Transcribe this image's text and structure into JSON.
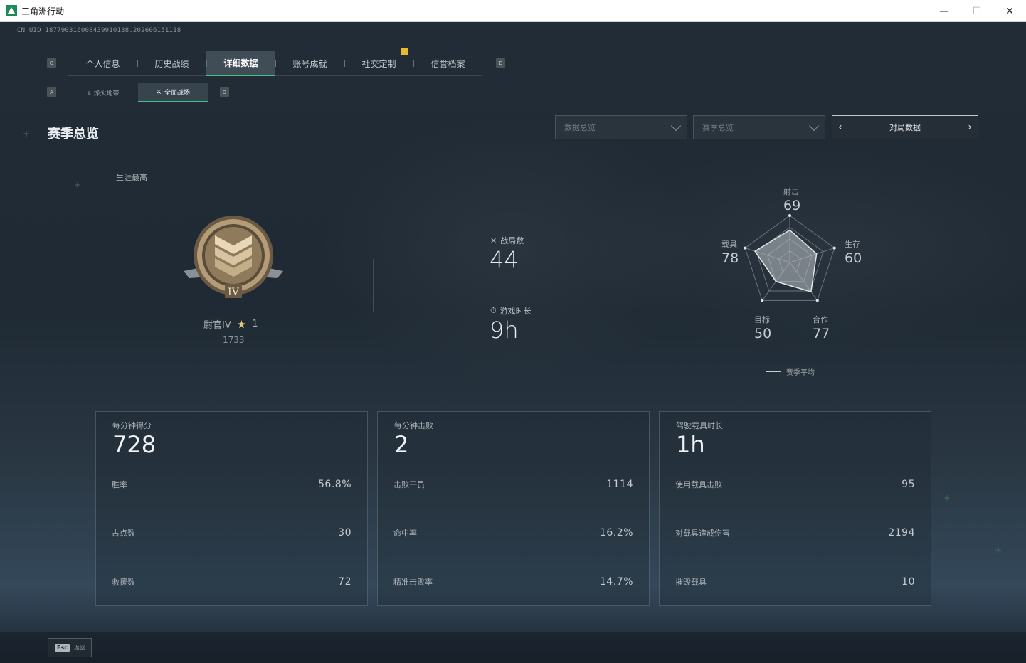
{
  "window": {
    "title": "三角洲行动",
    "minimize": "—",
    "maximize": "☐",
    "close": "✕"
  },
  "uid": "CN UID 187790316008439910138.202606151118",
  "tabs": {
    "key_left": "Q",
    "key_right": "E",
    "items": [
      {
        "label": "个人信息"
      },
      {
        "label": "历史战绩"
      },
      {
        "label": "详细数据"
      },
      {
        "label": "账号成就"
      },
      {
        "label": "社交定制"
      },
      {
        "label": "信誉档案"
      }
    ],
    "active_index": 2,
    "notification_tab_index": 4
  },
  "subtabs": {
    "key_left": "A",
    "key_right": "D",
    "items": [
      {
        "label": "烽火地带",
        "icon": "flame-zone-icon"
      },
      {
        "label": "全面战场",
        "icon": "battlefield-icon"
      }
    ],
    "active_index": 1
  },
  "section": {
    "title": "赛季总览",
    "dropdown1": "数据总览",
    "dropdown2": "赛季总览",
    "pager_label": "对局数据",
    "pager_prev": "‹",
    "pager_next": "›"
  },
  "rank": {
    "career_label": "生涯最高",
    "name": "尉官IV",
    "stars": "1",
    "score": "1733",
    "badge_numeral": "IV"
  },
  "summary": {
    "matches_label": "战局数",
    "matches_value": "44",
    "playtime_label": "游戏时长",
    "playtime_value": "9h"
  },
  "radar": {
    "axes": [
      {
        "label": "射击",
        "value": "69"
      },
      {
        "label": "生存",
        "value": "60"
      },
      {
        "label": "合作",
        "value": "77"
      },
      {
        "label": "目标",
        "value": "50"
      },
      {
        "label": "载具",
        "value": "78"
      }
    ],
    "legend": "赛季平均"
  },
  "panels": [
    {
      "title": "每分钟得分",
      "big": "728",
      "rows": [
        {
          "label": "胜率",
          "value": "56.8%"
        },
        {
          "label": "占点数",
          "value": "30"
        },
        {
          "label": "救援数",
          "value": "72"
        }
      ]
    },
    {
      "title": "每分钟击败",
      "big": "2",
      "rows": [
        {
          "label": "击败干员",
          "value": "1114"
        },
        {
          "label": "命中率",
          "value": "16.2%"
        },
        {
          "label": "精准击败率",
          "value": "14.7%"
        }
      ]
    },
    {
      "title": "驾驶载具时长",
      "big": "1h",
      "rows": [
        {
          "label": "使用载具击败",
          "value": "95"
        },
        {
          "label": "对载具造成伤害",
          "value": "2194"
        },
        {
          "label": "摧毁载具",
          "value": "10"
        }
      ]
    }
  ],
  "footer": {
    "esc_key": "Esc",
    "esc_label": "返回"
  },
  "colors": {
    "accent": "#3fc18a",
    "notification": "#e8b830",
    "star": "#e8c97a"
  }
}
